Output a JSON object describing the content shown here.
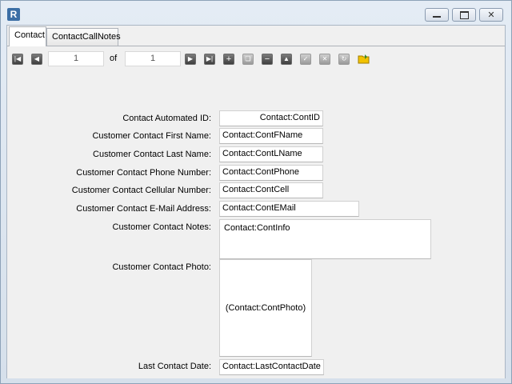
{
  "window": {
    "icon_glyph": "R",
    "min_icon": "minimize-icon",
    "max_icon": "maximize-icon",
    "close_icon": "close-icon"
  },
  "tabs": [
    {
      "label": "Contact",
      "active": true
    },
    {
      "label": "ContactCallNotes",
      "active": false
    }
  ],
  "navigator": {
    "current_record": "1",
    "of_label": "of",
    "total_records": "1"
  },
  "fields": [
    {
      "label": "Contact Automated ID:",
      "value": "Contact:ContID"
    },
    {
      "label": "Customer Contact First Name:",
      "value": "Contact:ContFName"
    },
    {
      "label": "Customer Contact Last Name:",
      "value": "Contact:ContLName"
    },
    {
      "label": "Customer Contact Phone Number:",
      "value": "Contact:ContPhone"
    },
    {
      "label": "Customer Contact Cellular Number:",
      "value": "Contact:ContCell"
    },
    {
      "label": "Customer Contact E-Mail Address:",
      "value": "Contact:ContEMail"
    },
    {
      "label": "Customer Contact Notes:",
      "value": "Contact:ContInfo"
    },
    {
      "label": "Customer Contact Photo:",
      "value": "(Contact:ContPhoto)"
    },
    {
      "label": "Last Contact Date:",
      "value": "Contact:LastContactDate"
    }
  ],
  "colors": {
    "title_bar": "#dfe6ee",
    "client_bg": "#f0f0f0",
    "nav_folder_accent": "#f2c200"
  }
}
